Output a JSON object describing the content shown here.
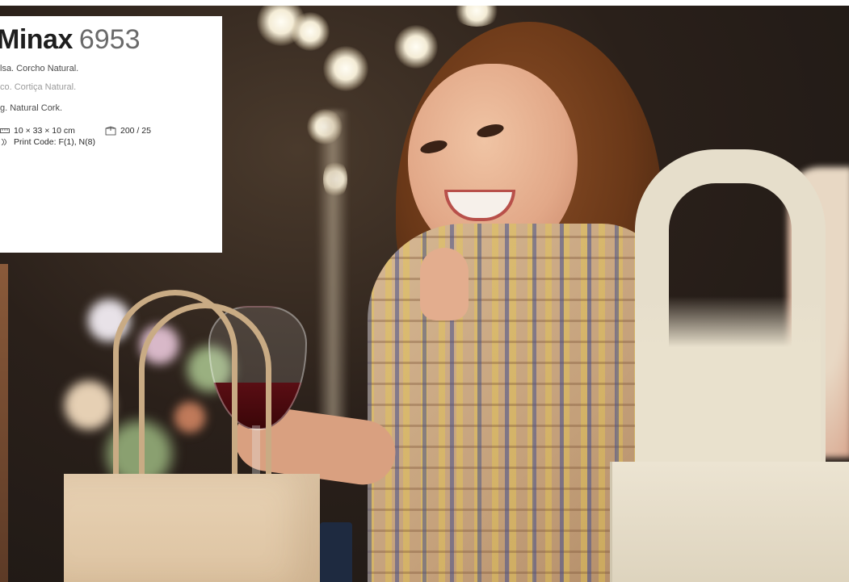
{
  "product": {
    "name": "Minax",
    "code": "6953",
    "desc_es": "lsa. Corcho Natural.",
    "desc_pt": "co. Cortiça Natural.",
    "desc_en": "g. Natural Cork.",
    "dimensions": "10 × 33 × 10 cm",
    "packaging": "200 / 25",
    "print_code": "Print Code: F(1), N(8)"
  },
  "icons": {
    "dimensions": "ruler-icon",
    "packaging": "box-icon",
    "print": "print-icon"
  }
}
